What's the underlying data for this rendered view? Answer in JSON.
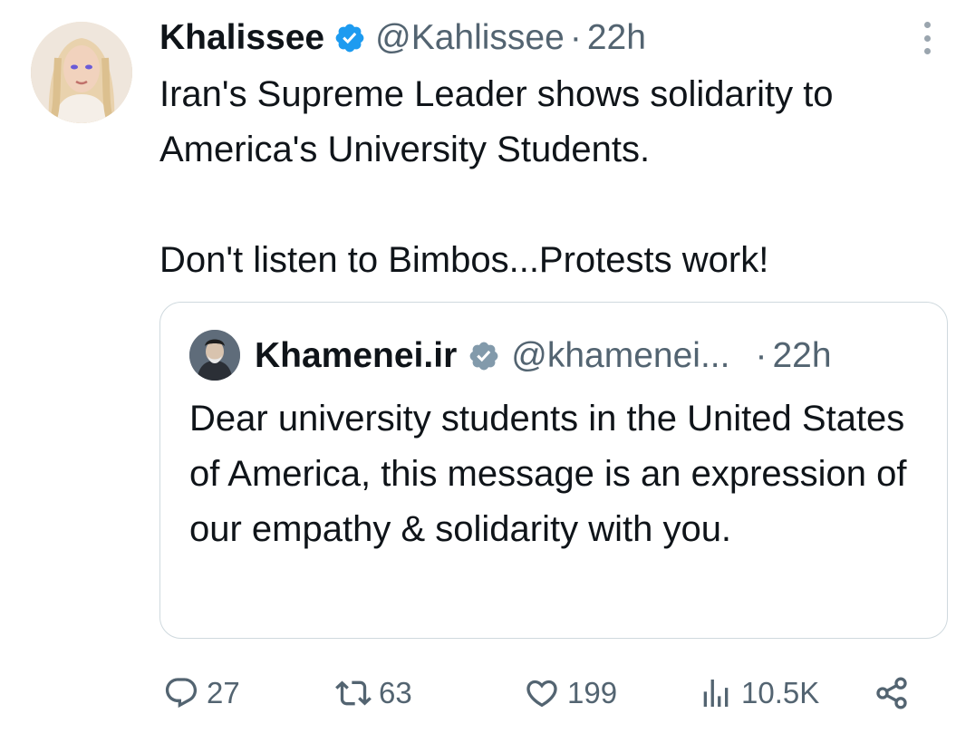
{
  "tweet": {
    "display_name": "Khalissee",
    "handle": "@Kahlissee",
    "separator": "·",
    "time": "22h",
    "text_paragraph_1": "Iran's Supreme Leader shows solidarity to America's University Students.",
    "text_paragraph_2": "Don't listen to Bimbos...Protests work!",
    "verified_icon": "verified-badge-icon",
    "verified_color": "#1d9bf0"
  },
  "quote": {
    "display_name": "Khamenei.ir",
    "handle": "@khamenei...",
    "separator": "·",
    "time": "22h",
    "text": "Dear university students in the United States of America, this message is an expression of our empathy & solidarity with you.",
    "verified_icon": "verified-badge-icon",
    "verified_color": "#829aab"
  },
  "actions": {
    "reply": {
      "icon": "reply-icon",
      "count": "27"
    },
    "retweet": {
      "icon": "retweet-icon",
      "count": "63"
    },
    "like": {
      "icon": "heart-icon",
      "count": "199"
    },
    "views": {
      "icon": "views-icon",
      "count": "10.5K"
    },
    "share": {
      "icon": "share-icon"
    }
  },
  "colors": {
    "text": "#0f1419",
    "secondary": "#536471",
    "border": "#cfd9de"
  }
}
